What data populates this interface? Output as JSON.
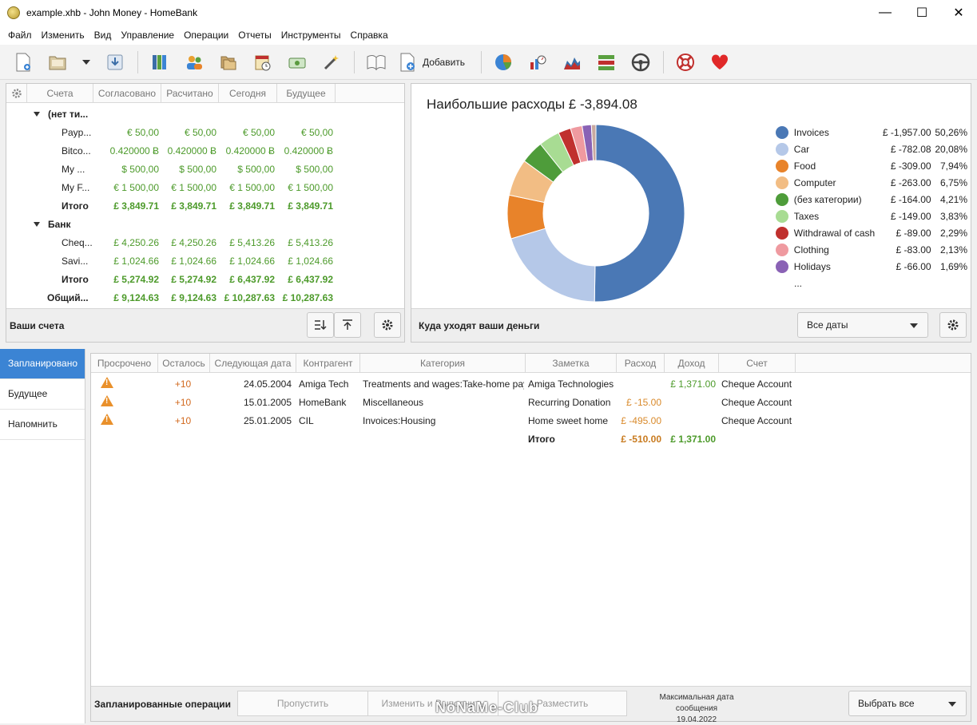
{
  "window": {
    "title": "example.xhb - John Money - HomeBank",
    "minimize": "—",
    "maximize": "☐",
    "close": "✕"
  },
  "menu": [
    "Файл",
    "Изменить",
    "Вид",
    "Управление",
    "Операции",
    "Отчеты",
    "Инструменты",
    "Справка"
  ],
  "toolbar": {
    "add_label": "Добавить"
  },
  "accounts": {
    "headers": [
      "Счета",
      "Согласовано",
      "Расчитано",
      "Сегодня",
      "Будущее"
    ],
    "groups": [
      {
        "name": "(нет ти...",
        "rows": [
          {
            "name": "Payp...",
            "values": [
              "€ 50,00",
              "€ 50,00",
              "€ 50,00",
              "€ 50,00"
            ]
          },
          {
            "name": "Bitco...",
            "values": [
              "0.420000 Ƀ",
              "0.420000 Ƀ",
              "0.420000 Ƀ",
              "0.420000 Ƀ"
            ]
          },
          {
            "name": "My ...",
            "values": [
              "$ 500,00",
              "$ 500,00",
              "$ 500,00",
              "$ 500,00"
            ]
          },
          {
            "name": "My F...",
            "values": [
              "€ 1 500,00",
              "€ 1 500,00",
              "€ 1 500,00",
              "€ 1 500,00"
            ]
          }
        ],
        "total": {
          "name": "Итого",
          "values": [
            "£ 3,849.71",
            "£ 3,849.71",
            "£ 3,849.71",
            "£ 3,849.71"
          ]
        }
      },
      {
        "name": "Банк",
        "rows": [
          {
            "name": "Cheq...",
            "values": [
              "£ 4,250.26",
              "£ 4,250.26",
              "£ 5,413.26",
              "£ 5,413.26"
            ]
          },
          {
            "name": "Savi...",
            "values": [
              "£ 1,024.66",
              "£ 1,024.66",
              "£ 1,024.66",
              "£ 1,024.66"
            ]
          }
        ],
        "total": {
          "name": "Итого",
          "values": [
            "£ 5,274.92",
            "£ 5,274.92",
            "£ 6,437.92",
            "£ 6,437.92"
          ]
        }
      }
    ],
    "grand_total": {
      "name": "Общий...",
      "values": [
        "£ 9,124.63",
        "£ 9,124.63",
        "£ 10,287.63",
        "£ 10,287.63"
      ]
    },
    "footer_label": "Ваши счета"
  },
  "spending": {
    "title": "Наибольшие расходы £ -3,894.08",
    "footer_label": "Куда уходят ваши деньги",
    "date_filter": "Все даты",
    "more": "..."
  },
  "chart_data": {
    "type": "pie",
    "title": "Наибольшие расходы £ -3,894.08",
    "legend_position": "right",
    "slices": [
      {
        "name": "Invoices",
        "amount": "£ -1,957.00",
        "percent": "50,26%",
        "value": 50.26,
        "color": "#4a78b5"
      },
      {
        "name": "Car",
        "amount": "£ -782.08",
        "percent": "20,08%",
        "value": 20.08,
        "color": "#b5c8e8"
      },
      {
        "name": "Food",
        "amount": "£ -309.00",
        "percent": "7,94%",
        "value": 7.94,
        "color": "#e8832a"
      },
      {
        "name": "Computer",
        "amount": "£ -263.00",
        "percent": "6,75%",
        "value": 6.75,
        "color": "#f2bd84"
      },
      {
        "name": "(без категории)",
        "amount": "£ -164.00",
        "percent": "4,21%",
        "value": 4.21,
        "color": "#4e9c3a"
      },
      {
        "name": "Taxes",
        "amount": "£ -149.00",
        "percent": "3,83%",
        "value": 3.83,
        "color": "#a8dc93"
      },
      {
        "name": "Withdrawal of cash",
        "amount": "£ -89.00",
        "percent": "2,29%",
        "value": 2.29,
        "color": "#c0302e"
      },
      {
        "name": "Clothing",
        "amount": "£ -83.00",
        "percent": "2,13%",
        "value": 2.13,
        "color": "#ef9aa0"
      },
      {
        "name": "Holidays",
        "amount": "£ -66.00",
        "percent": "1,69%",
        "value": 1.69,
        "color": "#8a62b5"
      },
      {
        "name": "",
        "amount": "",
        "percent": "",
        "value": 0.82,
        "color": "#c9a9a0"
      }
    ]
  },
  "tabs": [
    "Запланировано",
    "Будущее",
    "Напомнить"
  ],
  "scheduled": {
    "headers": [
      "Просрочено",
      "Осталось",
      "Следующая дата",
      "Контрагент",
      "Категория",
      "Заметка",
      "Расход",
      "Доход",
      "Счет"
    ],
    "rows": [
      {
        "late": "+10",
        "next": "24.05.2004",
        "payee": "Amiga Tech",
        "category": "Treatments and wages:Take-home pay",
        "memo": "Amiga Technologies",
        "expense": "",
        "income": "£ 1,371.00",
        "account": "Cheque Account"
      },
      {
        "late": "+10",
        "next": "15.01.2005",
        "payee": "HomeBank",
        "category": "Miscellaneous",
        "memo": "Recurring Donation",
        "expense": "£ -15.00",
        "income": "",
        "account": "Cheque Account"
      },
      {
        "late": "+10",
        "next": "25.01.2005",
        "payee": "CIL",
        "category": "Invoices:Housing",
        "memo": "Home sweet home",
        "expense": "£ -495.00",
        "income": "",
        "account": "Cheque Account"
      }
    ],
    "total": {
      "label": "Итого",
      "expense": "£ -510.00",
      "income": "£ 1,371.00"
    },
    "footer_label": "Запланированные операции",
    "skip": "Пропустить",
    "edit_post": "Изменить и Выполнить",
    "post": "Разместить",
    "max_date_label": "Максимальная дата сообщения",
    "max_date": "19.04.2022",
    "select_all": "Выбрать все"
  },
  "watermark": "NoNaMe-Club"
}
